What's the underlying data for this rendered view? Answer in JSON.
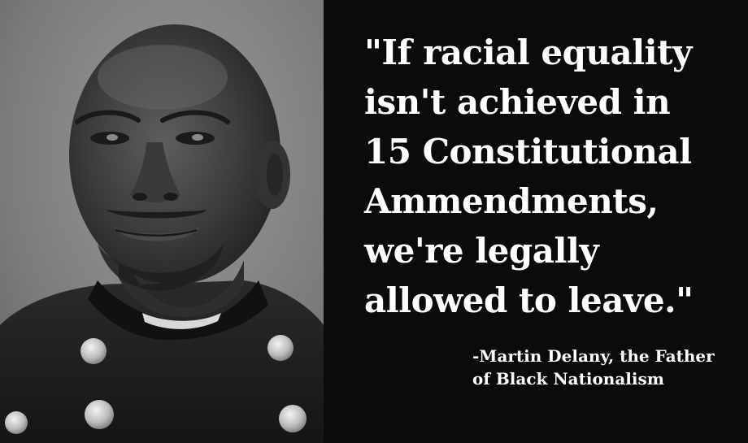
{
  "quote": {
    "lines": [
      "\"If racial equality",
      "isn't achieved in",
      "15 Constitutional",
      "Ammendments,",
      "we're legally",
      "allowed to leave.\""
    ]
  },
  "attribution": {
    "lines": [
      "-Martin Delany, the Father",
      "of Black Nationalism"
    ]
  },
  "colors": {
    "background": "#0b0b0b",
    "text": "#ffffff"
  },
  "icons": {
    "portrait": "grayscale-portrait-photo"
  }
}
